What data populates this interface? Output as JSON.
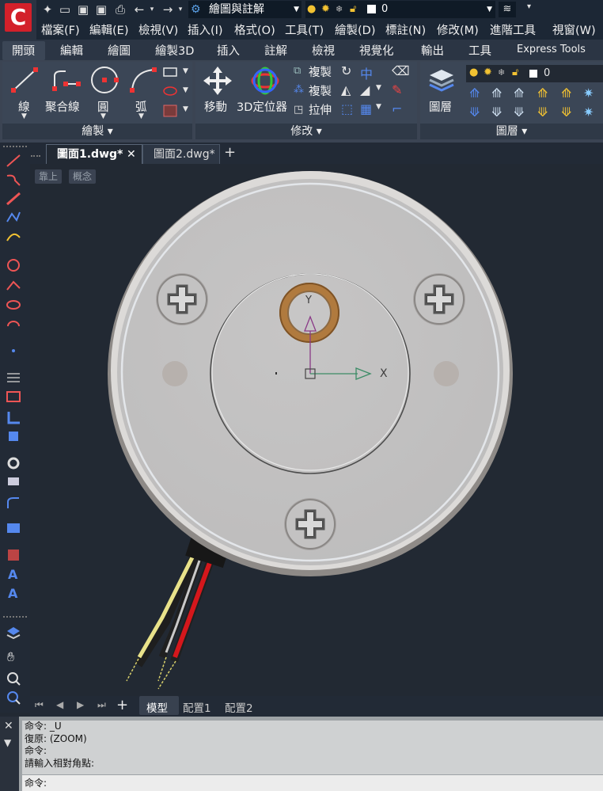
{
  "title_bar": {
    "workspace": "繪圖與註解",
    "layer_name": "0"
  },
  "menu": [
    "檔案(F)",
    "編輯(E)",
    "檢視(V)",
    "插入(I)",
    "格式(O)",
    "工具(T)",
    "繪製(D)",
    "標註(N)",
    "修改(M)",
    "進階工具",
    "視窗(W)"
  ],
  "ribbon_tabs": [
    "開頭",
    "編輯",
    "繪圖",
    "繪製3D",
    "插入",
    "註解",
    "檢視",
    "視覺化",
    "輸出",
    "工具",
    "Express Tools"
  ],
  "ribbon": {
    "draw": {
      "line": "線",
      "polyline": "聚合線",
      "circle": "圓",
      "arc": "弧",
      "title": "繪製 ▾"
    },
    "modify": {
      "move": "移動",
      "gizmo": "3D定位器",
      "copy1": "複製",
      "copy2": "複製",
      "stretch": "拉伸",
      "title": "修改 ▾"
    },
    "layers": {
      "layer_btn": "圖層",
      "layer_name": "0",
      "title": "圖層 ▾"
    }
  },
  "doc_tabs": [
    "圖面1.dwg*",
    "圖面2.dwg*"
  ],
  "view_labels": [
    "靠上",
    "概念"
  ],
  "layout_tabs": [
    "模型",
    "配置1",
    "配置2"
  ],
  "command": {
    "history": [
      "命令: _U",
      "復原: (ZOOM)",
      "命令:",
      "請輸入相對角點:"
    ],
    "prompt": "命令:"
  },
  "ucs": {
    "x": "X",
    "y": "Y"
  },
  "colors": {
    "accent_red": "#d3202a",
    "bronze": "#b07a3e",
    "plate": "#c2c1c1"
  }
}
